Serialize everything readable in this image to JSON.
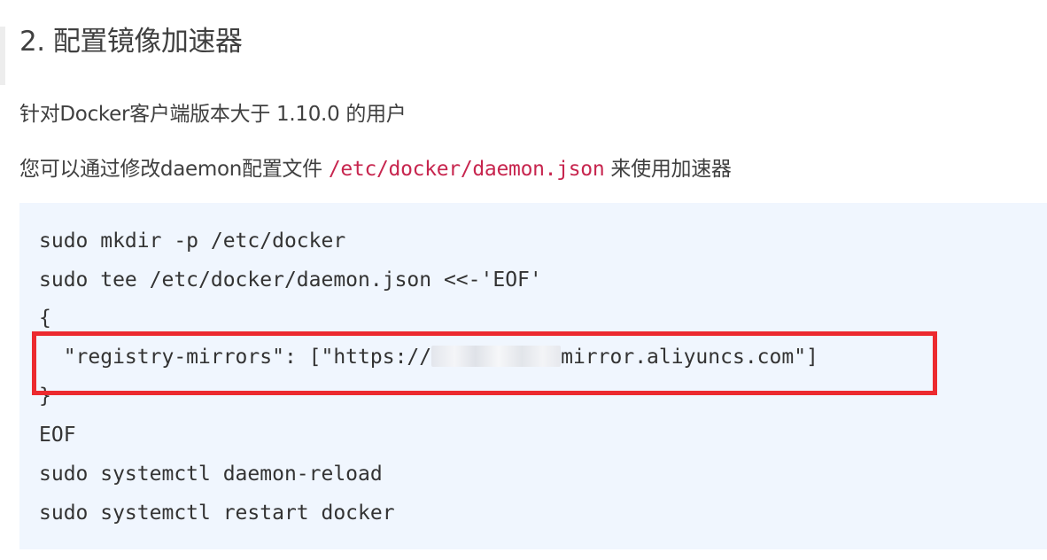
{
  "heading": "2. 配置镜像加速器",
  "intro": "针对Docker客户端版本大于 1.10.0 的用户",
  "usage": {
    "prefix": "您可以通过修改daemon配置文件 ",
    "path": "/etc/docker/daemon.json",
    "suffix": " 来使用加速器"
  },
  "code": {
    "line1": "sudo mkdir -p /etc/docker",
    "line2": "sudo tee /etc/docker/daemon.json <<-'EOF'",
    "line3": "{",
    "line4_prefix": "  \"registry-mirrors\": [\"https://",
    "line4_suffix": "mirror.aliyuncs.com\"]",
    "line5": "}",
    "line6": "EOF",
    "line7": "sudo systemctl daemon-reload",
    "line8": "sudo systemctl restart docker"
  },
  "colors": {
    "code_background": "#f0f6fe",
    "inline_path": "#c7254e",
    "highlight_border": "#ec2a2f"
  }
}
